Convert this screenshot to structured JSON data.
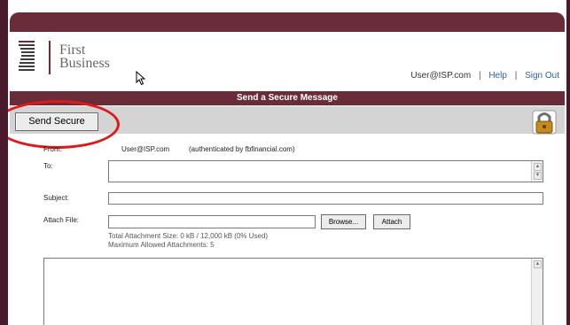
{
  "header": {
    "logo_text_line1": "First",
    "logo_text_line2": "Business",
    "user": "User@ISP.com",
    "help_label": "Help",
    "signout_label": "Sign Out",
    "separator": "|"
  },
  "title_bar": {
    "title": "Send a Secure Message"
  },
  "toolbar": {
    "send_label": "Send Secure"
  },
  "form": {
    "from_label": "From:",
    "from_value": "User@ISP.com",
    "from_auth": "(authenticated by fbfinancial.com)",
    "to_label": "To:",
    "to_value": "",
    "subject_label": "Subject:",
    "subject_value": "",
    "attach_label": "Attach File:",
    "attach_value": "",
    "browse_label": "Browse...",
    "attach_button_label": "Attach",
    "attachment_size": "Total Attachment Size: 0 kB / 12,000 kB (0% Used)",
    "max_attachments": "Maximum Allowed Attachments: 5",
    "body_value": ""
  },
  "colors": {
    "brand_maroon": "#6b2c3a",
    "toolbar_gray": "#d4d4d4",
    "link_blue": "#2d5fa8",
    "highlight_red": "#e01818"
  },
  "icons": {
    "logo": "first-business-logo",
    "cursor": "mouse-cursor-icon",
    "lock": "padlock-icon"
  }
}
